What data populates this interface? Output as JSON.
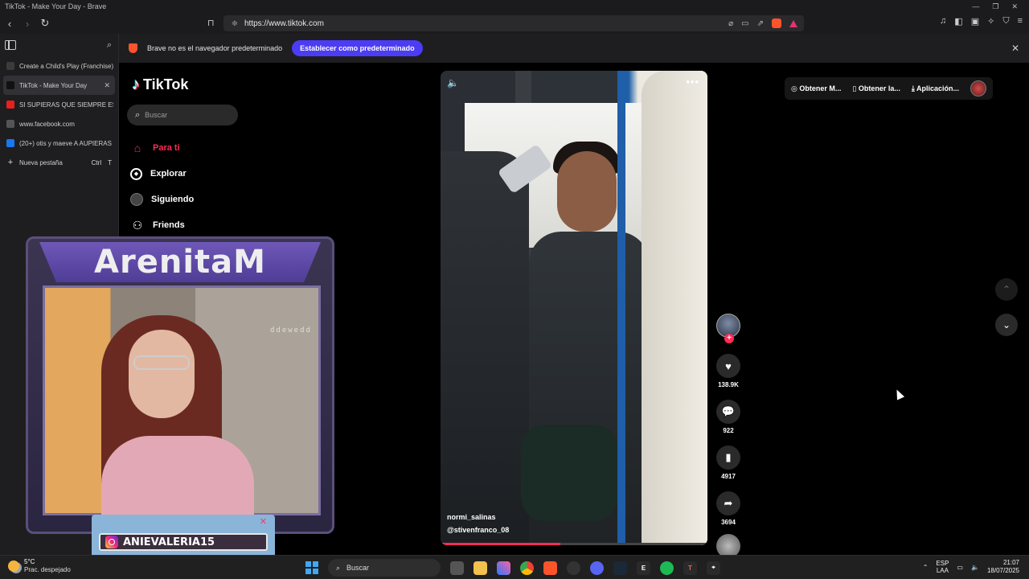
{
  "window": {
    "title": "TikTok - Make Your Day - Brave"
  },
  "toolbar": {
    "url": "https://www.tiktok.com"
  },
  "vertical_tabs": [
    {
      "label": "Create a Child's Play (Franchise)",
      "favicon_color": "#3b3b3b",
      "active": false
    },
    {
      "label": "TikTok - Make Your Day",
      "favicon_color": "#111111",
      "active": true
    },
    {
      "label": "SI SUPIERAS QUE SIEMPRE ESTUVE",
      "favicon_color": "#e8201c",
      "active": false
    },
    {
      "label": "www.facebook.com",
      "favicon_color": "#555555",
      "active": false
    },
    {
      "label": "(20+) otis y maeve A AUPIERAS",
      "favicon_color": "#1877f2",
      "active": false
    }
  ],
  "new_tab": {
    "label": "Nueva pestaña",
    "shortcut_mod": "Ctrl",
    "shortcut_key": "T"
  },
  "infobar": {
    "message": "Brave no es el navegador predeterminado",
    "button": "Establecer como predeterminado"
  },
  "tiktok": {
    "logo_text": "TikTok",
    "search_placeholder": "Buscar",
    "nav": [
      {
        "label": "Para ti",
        "icon": "home-icon",
        "active": true
      },
      {
        "label": "Explorar",
        "icon": "compass-icon",
        "active": false
      },
      {
        "label": "Siguiendo",
        "icon": "following-avatar-icon",
        "active": false
      },
      {
        "label": "Friends",
        "icon": "friends-icon",
        "active": false
      }
    ],
    "top_right": {
      "get_coins": "Obtener M...",
      "get_app": "Obtener la...",
      "desktop_app": "Aplicación..."
    },
    "video": {
      "username": "normi_salinas",
      "mention": "@stivenfranco_08",
      "progress": 0.45
    },
    "actions": {
      "likes": "138.9K",
      "comments": "922",
      "saves": "4917",
      "shares": "3694"
    }
  },
  "overlay": {
    "streamer_name": "ArenitaM",
    "watermark": "ddewedd",
    "instagram_handle": "ANIEVALERIA15"
  },
  "taskbar": {
    "temperature": "5°C",
    "condition": "Prac. despejado",
    "search_label": "Buscar",
    "lang_top": "ESP",
    "lang_bottom": "LAA",
    "time": "21:07",
    "date": "18/07/2025"
  },
  "colors": {
    "tiktok_red": "#fe2c55",
    "brave_orange": "#fb542b",
    "infobar_button": "#4c3cf4"
  }
}
